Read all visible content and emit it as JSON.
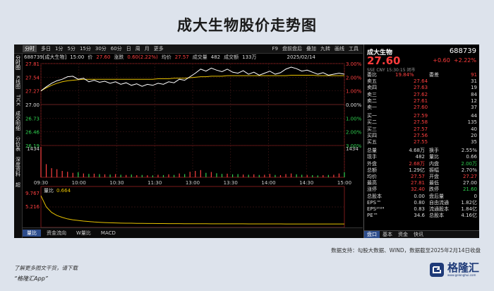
{
  "page": {
    "title": "成大生物股价走势图"
  },
  "toolbar": {
    "tabs": [
      "分时",
      "多日",
      "1分",
      "5分",
      "15分",
      "30分",
      "60分",
      "日",
      "周",
      "月",
      "更多"
    ],
    "right": [
      "F9",
      "盘前盘后",
      "叠加",
      "九转",
      "画线",
      "工具"
    ]
  },
  "left_tabs": [
    "分时图",
    "K线图",
    "TICK",
    "成交明细",
    "分价表",
    "深度资料",
    "超"
  ],
  "info_bar": {
    "code_name": "688739[成大生物]",
    "time": "15:00",
    "price_label": "价",
    "price": "27.60",
    "change_label": "涨跌",
    "change": "0.60(2.22%)",
    "avg_label": "均价",
    "avg": "27.57",
    "volume_label": "成交量",
    "volume": "482",
    "amount_label": "成交额",
    "amount": "133万",
    "date": "2025/02/14"
  },
  "axis": {
    "left_prices": [
      "27.81",
      "27.54",
      "27.27",
      "27.00",
      "26.73",
      "26.46",
      "26.19"
    ],
    "right_pcts": [
      "3.00%",
      "2.00%",
      "1.00%",
      "0.00%",
      "1.00%",
      "2.00%",
      "3.00%"
    ],
    "vol_left": "1434",
    "vol_right": "1434",
    "times": [
      "09:30",
      "10:00",
      "10:30",
      "11:30",
      "13:00",
      "13:30",
      "14:00",
      "14:30",
      "15:00"
    ]
  },
  "sub_chart": {
    "label": "量比",
    "value": "0.664",
    "y_top": "9.767",
    "y_mid": "5.216"
  },
  "bottom_tabs": [
    "量比",
    "资金流向",
    "W量比",
    "MACD"
  ],
  "right_panel": {
    "name": "成大生物",
    "code": "688739",
    "price": "27.60",
    "change": "+0.60",
    "change_pct": "+2.22%",
    "exchange_line": "SSE  CNY  15:30:15  闭市",
    "ratio_row": {
      "l1": "委比",
      "v1": "19.84%",
      "l2": "委差",
      "v2": "91"
    },
    "asks": [
      {
        "label": "卖五",
        "price": "27.64",
        "vol": "31"
      },
      {
        "label": "卖四",
        "price": "27.63",
        "vol": "19"
      },
      {
        "label": "卖三",
        "price": "27.62",
        "vol": "84"
      },
      {
        "label": "卖二",
        "price": "27.61",
        "vol": "12"
      },
      {
        "label": "卖一",
        "price": "27.60",
        "vol": "37"
      }
    ],
    "bids": [
      {
        "label": "买一",
        "price": "27.59",
        "vol": "44"
      },
      {
        "label": "买二",
        "price": "27.58",
        "vol": "135"
      },
      {
        "label": "买三",
        "price": "27.57",
        "vol": "40"
      },
      {
        "label": "买四",
        "price": "27.56",
        "vol": "20"
      },
      {
        "label": "买五",
        "price": "27.55",
        "vol": "35"
      }
    ],
    "stats": [
      {
        "l1": "总量",
        "v1": "4.68万",
        "c1": "wht",
        "l2": "换手",
        "v2": "2.55%",
        "c2": "wht"
      },
      {
        "l1": "现手",
        "v1": "482",
        "c1": "wht",
        "l2": "量比",
        "v2": "0.66",
        "c2": "wht"
      },
      {
        "l1": "外盘",
        "v1": "2.68万",
        "c1": "red",
        "l2": "内盘",
        "v2": "2.00万",
        "c2": "grn"
      },
      {
        "l1": "总额",
        "v1": "1.29亿",
        "c1": "wht",
        "l2": "振幅",
        "v2": "2.70%",
        "c2": "wht"
      },
      {
        "l1": "均价",
        "v1": "27.57",
        "c1": "red",
        "l2": "开盘",
        "v2": "27.27",
        "c2": "red"
      },
      {
        "l1": "最高",
        "v1": "27.81",
        "c1": "red",
        "l2": "最低",
        "v2": "27.00",
        "c2": "wht"
      },
      {
        "l1": "涨停",
        "v1": "32.40",
        "c1": "red",
        "l2": "跌停",
        "v2": "21.60",
        "c2": "grn"
      },
      {
        "l1": "总股本",
        "v1": "0.00",
        "c1": "wht",
        "l2": "盘后量",
        "v2": "0",
        "c2": "wht"
      },
      {
        "l1": "EPS™",
        "v1": "0.80",
        "c1": "wht",
        "l2": "自由流通",
        "v2": "1.82亿",
        "c2": "wht"
      },
      {
        "l1": "EPS²⁰²⁴",
        "v1": "0.83",
        "c1": "wht",
        "l2": "流通股本",
        "v2": "1.84亿",
        "c2": "wht"
      },
      {
        "l1": "PE™",
        "v1": "34.6",
        "c1": "wht",
        "l2": "总股本",
        "v2": "4.16亿",
        "c2": "wht"
      }
    ],
    "tabs": [
      "盘口",
      "基本",
      "资金",
      "快讯"
    ]
  },
  "footer": {
    "source": "数据支持：勾股大数据、WIND，数据截至2025年2月14日收盘",
    "ad_line1": "了解更多图文干货，请下载",
    "ad_line2": "“格隆汇App”",
    "logo_name": "格隆汇",
    "logo_url": "www.gelonghui.com"
  },
  "chart_data": {
    "type": "line",
    "ylim": [
      26.19,
      27.81
    ],
    "prev_close": 27.0,
    "price": [
      27.27,
      27.35,
      27.42,
      27.47,
      27.5,
      27.55,
      27.56,
      27.5,
      27.52,
      27.45,
      27.48,
      27.44,
      27.46,
      27.42,
      27.45,
      27.4,
      27.43,
      27.38,
      27.41,
      27.36,
      27.4,
      27.38,
      27.42,
      27.4,
      27.45,
      27.43,
      27.5,
      27.48,
      27.55,
      27.62,
      27.7,
      27.66,
      27.72,
      27.68,
      27.65,
      27.7,
      27.64,
      27.62,
      27.67,
      27.6,
      27.64,
      27.58,
      27.62,
      27.66,
      27.6,
      27.63,
      27.7,
      27.74,
      27.71,
      27.66,
      27.68,
      27.64,
      27.6,
      27.63,
      27.58,
      27.6,
      27.62,
      27.6
    ],
    "avg": [
      27.27,
      27.33,
      27.38,
      27.42,
      27.45,
      27.47,
      27.48,
      27.49,
      27.5,
      27.5,
      27.5,
      27.5,
      27.5,
      27.5,
      27.5,
      27.5,
      27.5,
      27.5,
      27.5,
      27.5,
      27.5,
      27.5,
      27.51,
      27.51,
      27.51,
      27.52,
      27.52,
      27.52,
      27.53,
      27.54,
      27.55,
      27.55,
      27.56,
      27.56,
      27.56,
      27.57,
      27.57,
      27.57,
      27.57,
      27.57,
      27.57,
      27.57,
      27.57,
      27.57,
      27.57,
      27.57,
      27.57,
      27.58,
      27.58,
      27.58,
      27.58,
      27.58,
      27.57,
      27.57,
      27.57,
      27.57,
      27.57,
      27.57
    ],
    "volume": [
      1434,
      620,
      430,
      380,
      300,
      260,
      210,
      240,
      180,
      160,
      170,
      150,
      140,
      130,
      150,
      120,
      110,
      130,
      100,
      110,
      95,
      90,
      120,
      105,
      140,
      110,
      180,
      150,
      260,
      300,
      340,
      210,
      250,
      190,
      160,
      170,
      140,
      150,
      130,
      120,
      140,
      110,
      120,
      160,
      110,
      100,
      150,
      180,
      140,
      120,
      110,
      100,
      90,
      100,
      110,
      120,
      180,
      240
    ],
    "vol_ratio": [
      9.767,
      6.2,
      4.4,
      3.4,
      2.8,
      2.3,
      2.0,
      1.8,
      1.6,
      1.45,
      1.3,
      1.2,
      1.12,
      1.05,
      1.0,
      0.95,
      0.92,
      0.9,
      0.87,
      0.85,
      0.83,
      0.82,
      0.8,
      0.79,
      0.78,
      0.77,
      0.76,
      0.75,
      0.75,
      0.74,
      0.73,
      0.73,
      0.72,
      0.72,
      0.71,
      0.71,
      0.7,
      0.7,
      0.7,
      0.69,
      0.69,
      0.69,
      0.68,
      0.68,
      0.68,
      0.68,
      0.67,
      0.67,
      0.67,
      0.67,
      0.67,
      0.67,
      0.66,
      0.66,
      0.66,
      0.66,
      0.66,
      0.664
    ],
    "colors": {
      "price": "#ffffff",
      "avg": "#e8c200",
      "ratio": "#e8c200",
      "volume": "#ffffff"
    }
  }
}
